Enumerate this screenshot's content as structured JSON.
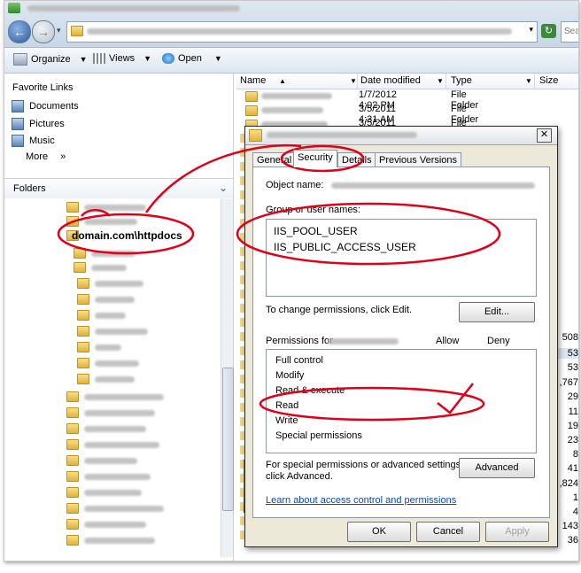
{
  "toolbar": {
    "organize": "Organize",
    "views": "Views",
    "open": "Open"
  },
  "search": {
    "placeholder": "Sea"
  },
  "favorites": {
    "title": "Favorite Links",
    "items": [
      "Documents",
      "Pictures",
      "Music"
    ],
    "more": "More",
    "more_arrow": "»"
  },
  "folders": {
    "label": "Folders",
    "highlighted": "domain.com\\httpdocs"
  },
  "columns": {
    "name": "Name",
    "date": "Date modified",
    "type": "Type",
    "size": "Size"
  },
  "files": [
    {
      "date": "1/7/2012 4:02 PM",
      "type": "File Folder"
    },
    {
      "date": "3/5/2011 4:31 AM",
      "type": "File Folder"
    },
    {
      "date": "3/5/2011 4:31 AM",
      "type": "File Folder"
    }
  ],
  "sizes": [
    "508",
    "53",
    "53",
    ",767",
    "29",
    "11",
    "19",
    "23",
    "8",
    "41",
    ",824",
    "1",
    "4",
    "143",
    "36"
  ],
  "dialog": {
    "tabs": [
      "General",
      "Security",
      "Details",
      "Previous Versions"
    ],
    "active_tab": "Security",
    "object_name_label": "Object name:",
    "group_label": "Group or user names:",
    "users": [
      "IIS_POOL_USER",
      "IIS_PUBLIC_ACCESS_USER"
    ],
    "change_text": "To change permissions, click Edit.",
    "edit_button": "Edit...",
    "permissions_label": "Permissions for",
    "allow": "Allow",
    "deny": "Deny",
    "permissions": [
      "Full control",
      "Modify",
      "Read & execute",
      "Read",
      "Write",
      "Special permissions"
    ],
    "special_text_1": "For special permissions or advanced settings,",
    "special_text_2": "click Advanced.",
    "advanced_button": "Advanced",
    "learn_link": "Learn about access control and permissions",
    "ok": "OK",
    "cancel": "Cancel",
    "apply": "Apply"
  },
  "colors": {
    "annotation": "#e0001a",
    "accent": "#2c5a9c"
  }
}
